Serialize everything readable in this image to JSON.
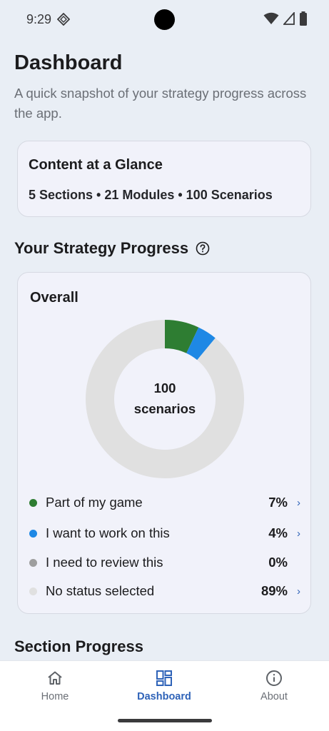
{
  "status_bar": {
    "time": "9:29"
  },
  "page": {
    "title": "Dashboard",
    "subtitle": "A quick snapshot of your strategy progress across the app."
  },
  "glance": {
    "title": "Content at a Glance",
    "stats": "5 Sections • 21 Modules • 100 Scenarios"
  },
  "progress": {
    "heading": "Your Strategy Progress",
    "help_icon": "help-circle-icon",
    "overall_title": "Overall",
    "center_count": "100",
    "center_unit": "scenarios",
    "legend": [
      {
        "label": "Part of my game",
        "pct_text": "7%",
        "value": 7,
        "color": "#2e7d32",
        "chevron": true
      },
      {
        "label": "I want to work on this",
        "pct_text": "4%",
        "value": 4,
        "color": "#1e88e5",
        "chevron": true
      },
      {
        "label": "I need to review this",
        "pct_text": "0%",
        "value": 0,
        "color": "#9e9e9e",
        "chevron": false
      },
      {
        "label": "No status selected",
        "pct_text": "89%",
        "value": 89,
        "color": "#e0e0e0",
        "chevron": true
      }
    ]
  },
  "section_progress": {
    "heading": "Section Progress"
  },
  "nav": {
    "items": [
      {
        "label": "Home",
        "icon": "home-icon",
        "active": false
      },
      {
        "label": "Dashboard",
        "icon": "dashboard-icon",
        "active": true
      },
      {
        "label": "About",
        "icon": "info-icon",
        "active": false
      }
    ]
  },
  "colors": {
    "accent": "#2f63b8",
    "background": "#e9eef5",
    "card": "#f1f2fa"
  }
}
